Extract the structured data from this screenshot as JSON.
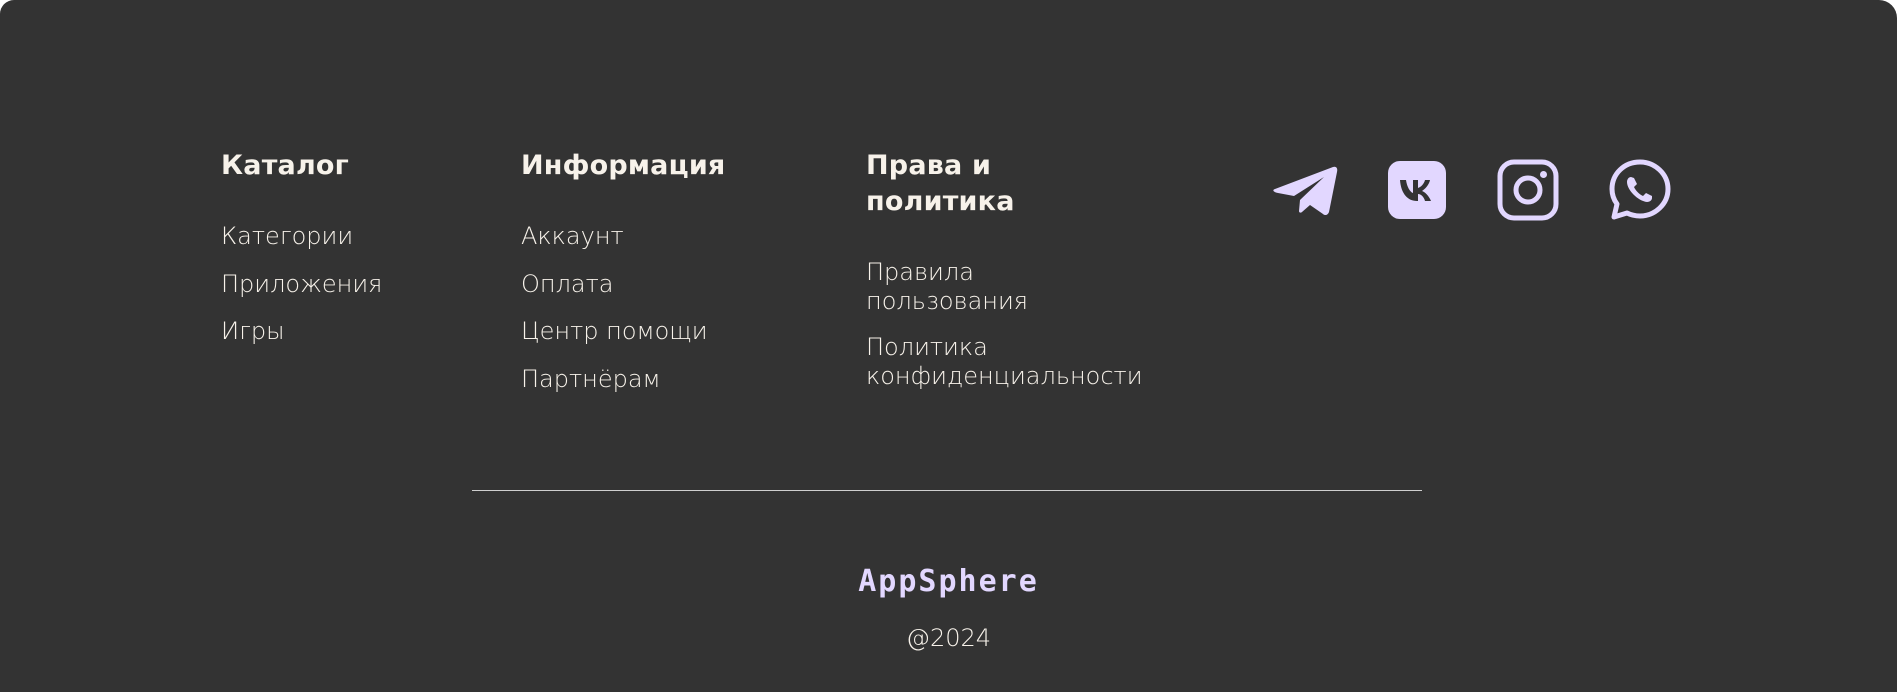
{
  "footer": {
    "catalog": {
      "title": "Каталог",
      "links": [
        "Категории",
        "Приложения",
        "Игры"
      ]
    },
    "info": {
      "title": "Информация",
      "links": [
        "Аккаунт",
        "Оплата",
        "Центр помощи",
        "Партнёрам"
      ]
    },
    "policy": {
      "title_line1": "Права и",
      "title_line2": "политика",
      "links": [
        {
          "line1": "Правила",
          "line2": "пользования"
        },
        {
          "line1": "Политика",
          "line2": "конфиденциальности"
        }
      ]
    },
    "socials": [
      "telegram-icon",
      "vk-icon",
      "instagram-icon",
      "whatsapp-icon"
    ],
    "brand": "AppSphere",
    "copyright": "@2024",
    "colors": {
      "background": "#333333",
      "text": "#f7f2ea",
      "accent": "#e2d7ff"
    }
  }
}
